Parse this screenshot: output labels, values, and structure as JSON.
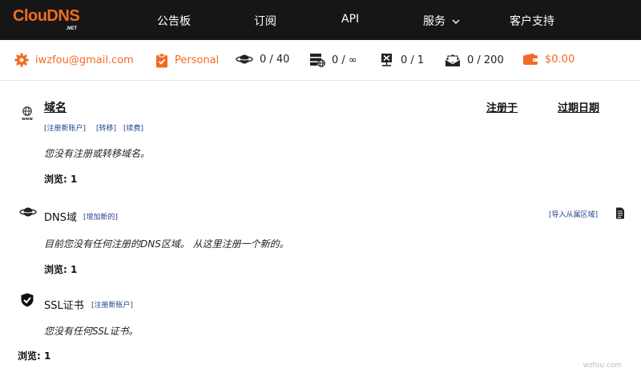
{
  "brand": {
    "logo_main": "ClouDNS",
    "logo_sub": ".NET",
    "color": "#f26b22"
  },
  "nav": {
    "bulletin": "公告板",
    "subscribe": "订阅",
    "api": "API",
    "services": "服务",
    "support": "客户支持"
  },
  "status": {
    "email": "iwzfou@gmail.com",
    "plan": "Personal",
    "dns_zones": "0 / 40",
    "cloud_domains": "0 / ∞",
    "monitoring": "0 / 1",
    "mail_forwards": "0 / 200",
    "balance": "$0.00"
  },
  "domains": {
    "title": "域名",
    "col_registrar": "注册于",
    "col_expiry": "过期日期",
    "link_register": "[注册新账户]",
    "link_transfer": "[转移]",
    "link_renew": "[续费]",
    "empty": "您没有注册或转移域名。",
    "browse": "浏览: 1"
  },
  "dns": {
    "title": "DNS域",
    "link_add": "[增加新的]",
    "link_import": "[导入从属区域]",
    "empty": "目前您没有任何注册的DNS区域。 从这里注册一个新的。",
    "browse": "浏览: 1"
  },
  "ssl": {
    "title": "SSL证书",
    "link_register": "[注册新账户]",
    "empty": "您没有任何SSL证书。",
    "browse": "浏览: 1"
  },
  "watermark": "wzfou.com",
  "icons": {
    "www": "www-globe-icon",
    "planet": "planet-icon",
    "shield": "shield-check-icon",
    "doc": "document-icon"
  }
}
